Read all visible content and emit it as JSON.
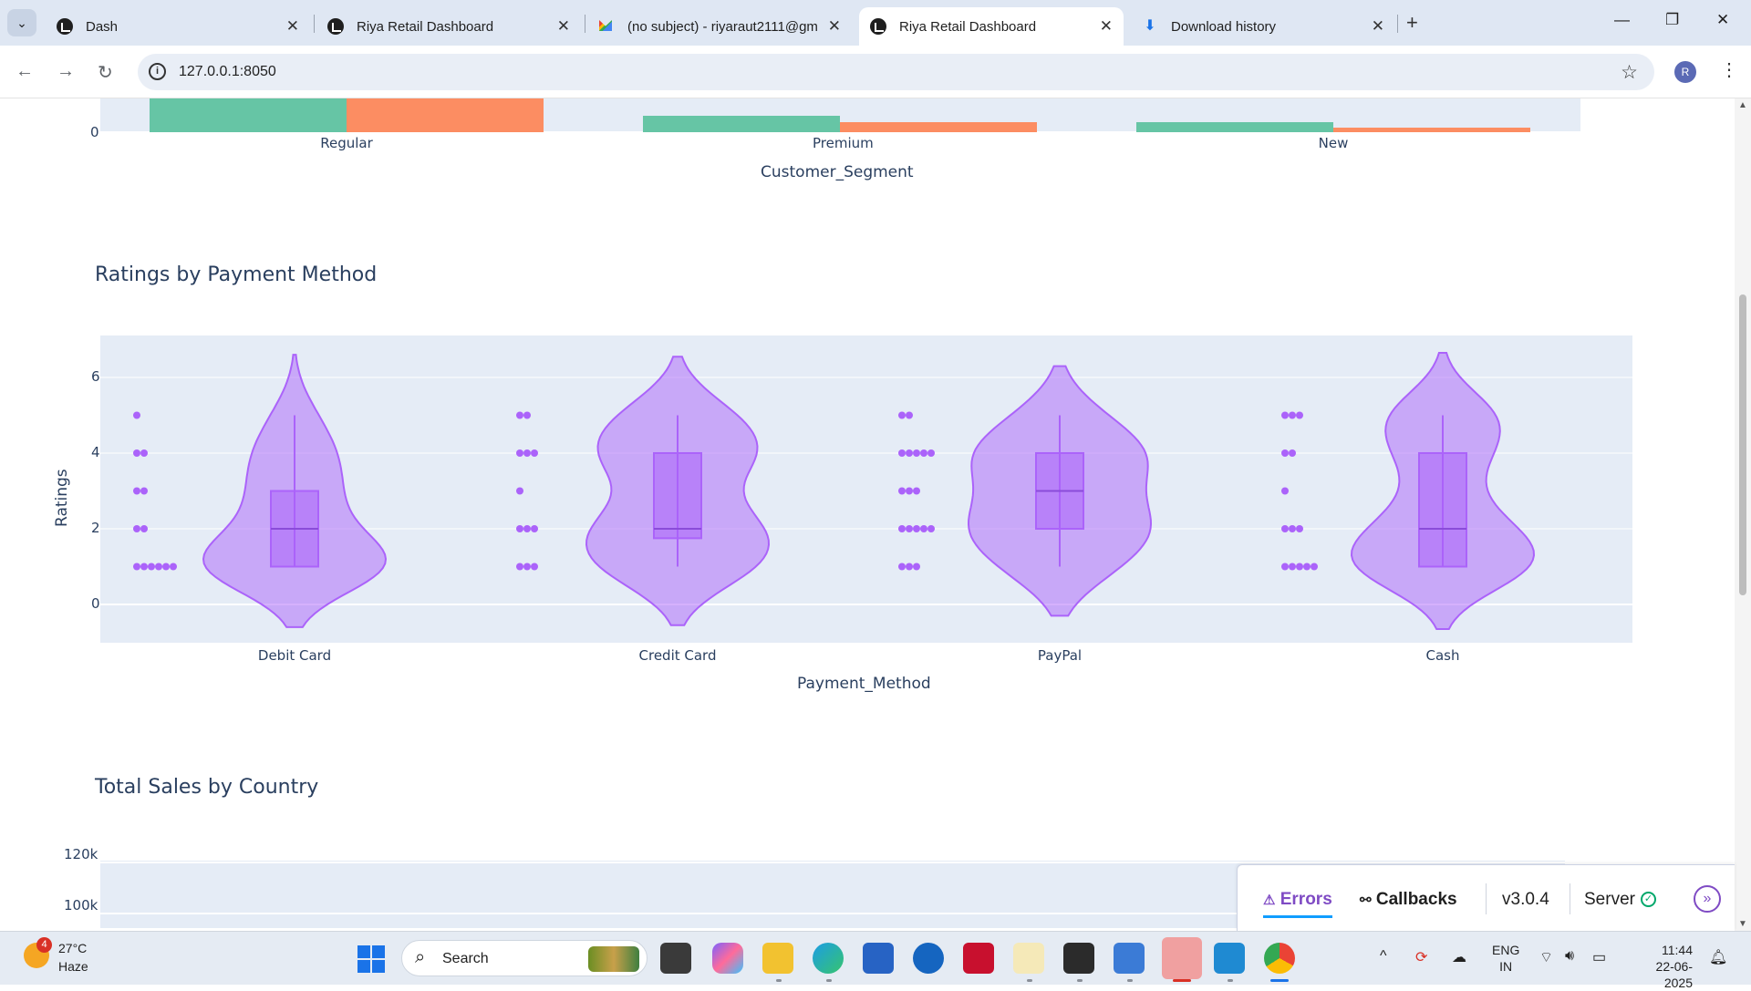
{
  "browser": {
    "tabs": [
      {
        "title": "Dash",
        "icon": "dash-icon"
      },
      {
        "title": "Riya Retail Dashboard",
        "icon": "dash-icon"
      },
      {
        "title": "(no subject) - riyaraut2111@gm",
        "icon": "gmail-icon"
      },
      {
        "title": "Riya Retail Dashboard",
        "icon": "dash-icon",
        "active": true
      },
      {
        "title": "Download history",
        "icon": "download-icon"
      }
    ],
    "url": "127.0.0.1:8050",
    "profile_initial": "R"
  },
  "segment_chart": {
    "chart_data": {
      "type": "bar",
      "xlabel": "Customer_Segment",
      "categories": [
        "Regular",
        "Premium",
        "New"
      ],
      "visible_y_tick": "0",
      "series_colors": [
        "#66c5a5",
        "#fc8d62"
      ]
    }
  },
  "payment_chart": {
    "chart_data": {
      "type": "violin",
      "title": "Ratings by Payment Method",
      "xlabel": "Payment_Method",
      "ylabel": "Ratings",
      "categories": [
        "Debit Card",
        "Credit Card",
        "PayPal",
        "Cash"
      ],
      "y_ticks": [
        "0",
        "2",
        "4",
        "6"
      ],
      "ylim": [
        -0.9,
        7.2
      ],
      "color": "#ab63fa",
      "box": [
        {
          "min": 1,
          "q1": 1,
          "median": 2,
          "q3": 3,
          "max": 5
        },
        {
          "min": 1,
          "q1": 1.75,
          "median": 2,
          "q3": 4,
          "max": 5
        },
        {
          "min": 1,
          "q1": 2,
          "median": 3,
          "q3": 4,
          "max": 5
        },
        {
          "min": 1,
          "q1": 1,
          "median": 2,
          "q3": 4,
          "max": 5
        }
      ],
      "violin_range": [
        [
          -0.6,
          6.6
        ],
        [
          -0.55,
          6.55
        ],
        [
          -0.3,
          6.3
        ],
        [
          -0.65,
          6.65
        ]
      ],
      "points": [
        [
          5,
          4,
          3,
          2,
          1,
          1,
          1,
          1,
          1,
          1,
          2,
          3,
          4
        ],
        [
          5,
          5,
          4,
          4,
          4,
          3,
          2,
          2,
          2,
          1,
          1,
          1
        ],
        [
          5,
          5,
          4,
          4,
          4,
          4,
          4,
          3,
          3,
          3,
          2,
          2,
          2,
          2,
          2,
          1,
          1,
          1
        ],
        [
          5,
          5,
          5,
          4,
          4,
          3,
          2,
          2,
          2,
          1,
          1,
          1,
          1,
          1
        ]
      ]
    }
  },
  "country_chart": {
    "chart_data": {
      "type": "bar",
      "title": "Total Sales by Country",
      "y_ticks": [
        "120k",
        "100k"
      ]
    }
  },
  "debug_menu": {
    "errors": "Errors",
    "callbacks": "Callbacks",
    "version": "v3.0.4",
    "server": "Server"
  },
  "taskbar": {
    "weather_badge": "4",
    "temperature": "27°C",
    "condition": "Haze",
    "search": "Search",
    "lang_1": "ENG",
    "lang_2": "IN",
    "time": "11:44",
    "date": "22-06-2025"
  }
}
